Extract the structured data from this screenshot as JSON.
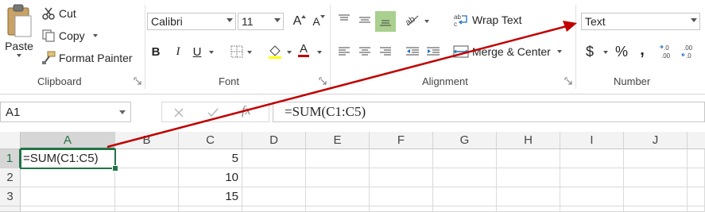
{
  "clipboard": {
    "paste_label": "Paste",
    "cut_label": "Cut",
    "copy_label": "Copy",
    "format_painter_label": "Format Painter",
    "group_label": "Clipboard"
  },
  "font": {
    "family": "Calibri",
    "size": "11",
    "group_label": "Font",
    "bold": "B",
    "italic": "I",
    "underline": "U",
    "grow": "A",
    "shrink": "A",
    "font_color": "A"
  },
  "alignment": {
    "wrap_text_label": "Wrap Text",
    "merge_center_label": "Merge & Center",
    "group_label": "Alignment"
  },
  "number": {
    "format": "Text",
    "currency": "$",
    "percent": "%",
    "comma": ",",
    "group_label": "Number"
  },
  "formula_bar": {
    "name_box": "A1",
    "formula": "=SUM(C1:C5)",
    "fx": "fx"
  },
  "sheet": {
    "columns": [
      "A",
      "B",
      "C",
      "D",
      "E",
      "F",
      "G",
      "H",
      "I",
      "J"
    ],
    "rows": [
      "1",
      "2",
      "3"
    ],
    "cells": {
      "A1": "=SUM(C1:C5)",
      "C1": "5",
      "C2": "10",
      "C3": "15"
    }
  },
  "colors": {
    "accent": "#217346",
    "annotation_arrow": "#c00000",
    "alignment_selected": "#a9d08e"
  }
}
